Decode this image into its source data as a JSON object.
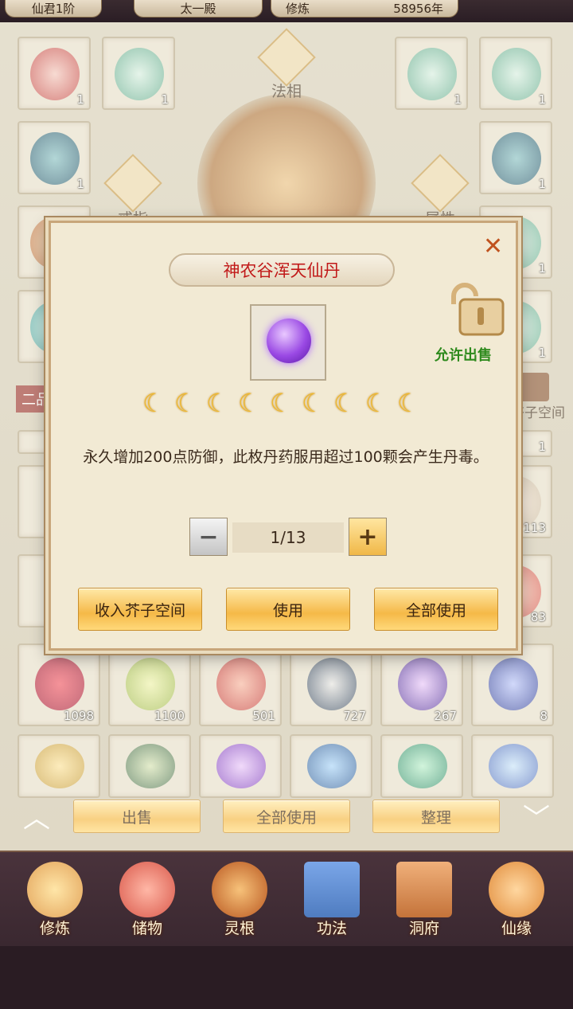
{
  "topbar": {
    "rank": "仙君1阶",
    "location": "太一殿",
    "cultivate_label": "修炼",
    "cultivate_years": "58956年"
  },
  "equipment": {
    "slot_faxiang": "法相",
    "slot_ring": "戒指",
    "slot_attr": "属性",
    "tab_grade": "二品",
    "mustard_space": "芥子空间"
  },
  "grid_counts": {
    "row1": [
      "1",
      "1",
      "1",
      "1"
    ],
    "row2": [
      "1",
      "1"
    ],
    "row3": [
      "1"
    ],
    "row4": [
      "1"
    ],
    "row5": [
      "1"
    ],
    "row6": [
      "113"
    ],
    "row7": [
      "83"
    ],
    "row8": [
      "1098",
      "1100",
      "501",
      "727",
      "267",
      "8"
    ]
  },
  "modal": {
    "title": "神农谷浑天仙丹",
    "allow_sale": "允许出售",
    "description": "永久增加200点防御，此枚丹药服用超过100颗会产生丹毒。",
    "quantity": "1/13",
    "minus": "−",
    "plus": "+",
    "close": "✕",
    "btn_store": "收入芥子空间",
    "btn_use": "使用",
    "btn_use_all": "全部使用",
    "moon_glyph": "☾",
    "moons": 9
  },
  "panel_buttons": {
    "sell": "出售",
    "use_all": "全部使用",
    "sort": "整理"
  },
  "nav": [
    {
      "label": "修炼",
      "color": "#e2a35a"
    },
    {
      "label": "储物",
      "color": "#d9584a"
    },
    {
      "label": "灵根",
      "color": "#b8561f"
    },
    {
      "label": "功法",
      "color": "#4f7cc0"
    },
    {
      "label": "洞府",
      "color": "#c4733a"
    },
    {
      "label": "仙缘",
      "color": "#e08b3a"
    }
  ]
}
